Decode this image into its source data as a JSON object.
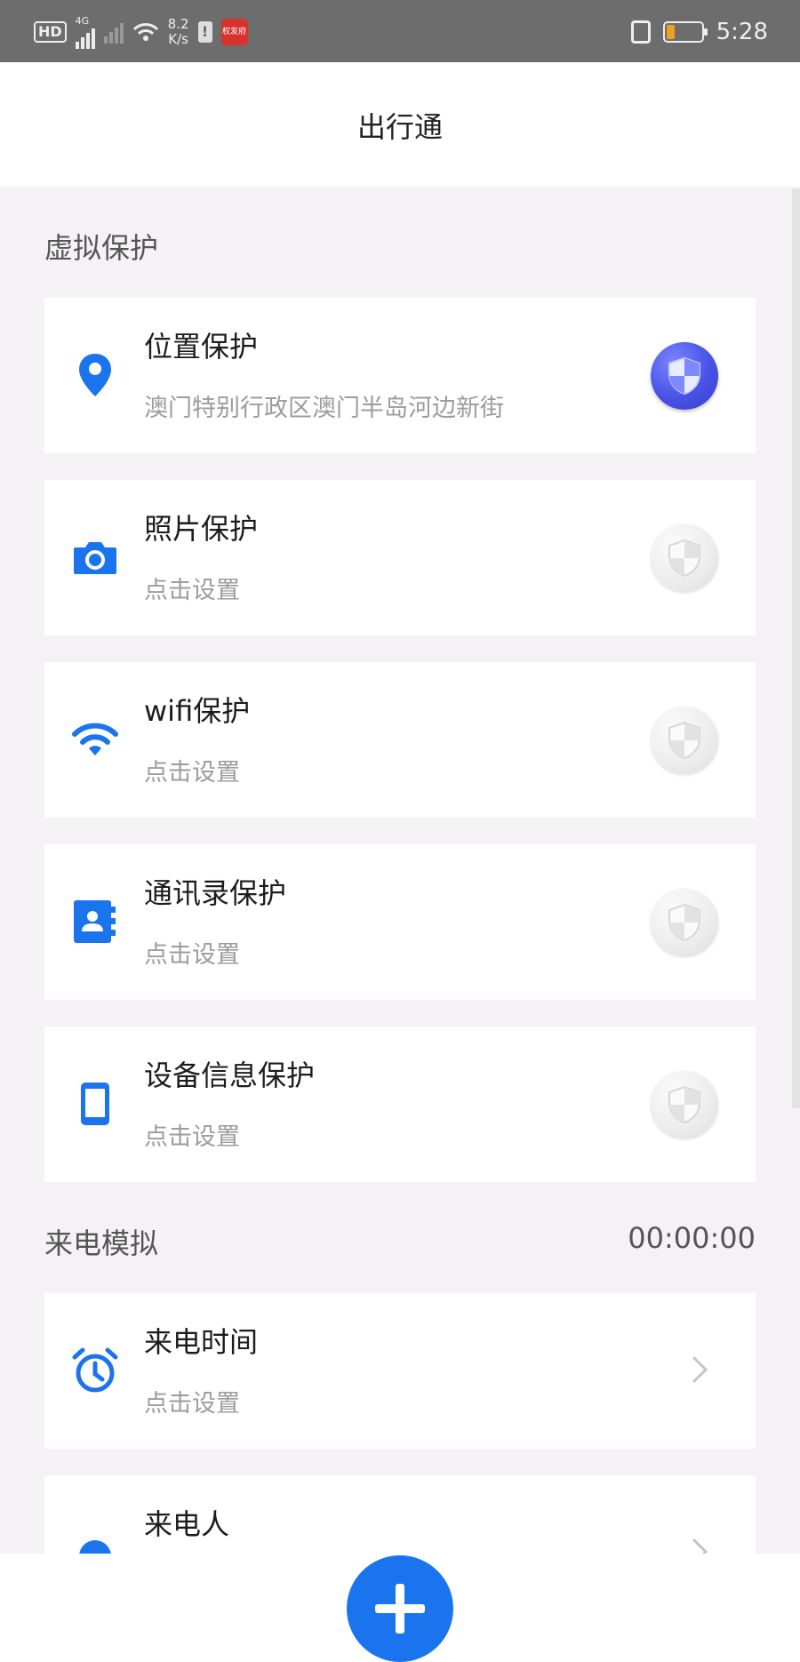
{
  "status_bar": {
    "hd": "HD",
    "network_type": "4G",
    "speed_value": "8.2",
    "speed_unit": "K/s",
    "app_badge": "权发府",
    "time": "5:28"
  },
  "header": {
    "title": "出行通"
  },
  "sections": {
    "protection": {
      "title": "虚拟保护"
    },
    "call": {
      "title": "来电模拟",
      "timer": "00:00:00"
    }
  },
  "protection_items": [
    {
      "title": "位置保护",
      "subtitle": "澳门特别行政区澳门半岛河边新街",
      "enabled": true,
      "icon": "location-pin-icon"
    },
    {
      "title": "照片保护",
      "subtitle": "点击设置",
      "enabled": false,
      "icon": "camera-icon"
    },
    {
      "title": "wifi保护",
      "subtitle": "点击设置",
      "enabled": false,
      "icon": "wifi-icon"
    },
    {
      "title": "通讯录保护",
      "subtitle": "点击设置",
      "enabled": false,
      "icon": "contacts-icon"
    },
    {
      "title": "设备信息保护",
      "subtitle": "点击设置",
      "enabled": false,
      "icon": "phone-device-icon"
    }
  ],
  "call_items": [
    {
      "title": "来电时间",
      "subtitle": "点击设置",
      "icon": "alarm-clock-icon"
    },
    {
      "title": "来电人",
      "subtitle": "",
      "icon": "person-icon"
    }
  ],
  "colors": {
    "accent": "#1a74ee",
    "shield_on": "#4852e6",
    "background": "#f4f2f4"
  }
}
